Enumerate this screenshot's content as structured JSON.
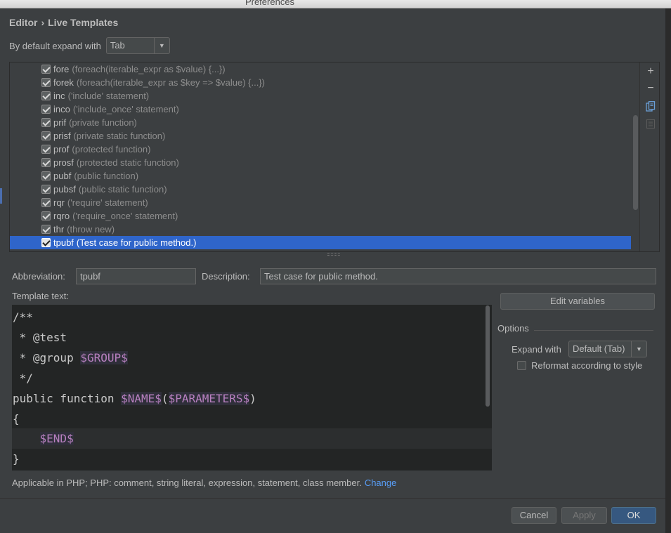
{
  "window": {
    "title": "Preferences"
  },
  "breadcrumb": {
    "parent": "Editor",
    "separator": "›",
    "current": "Live Templates"
  },
  "expand": {
    "label": "By default expand with",
    "value": "Tab"
  },
  "templates": [
    {
      "abbr": "fore",
      "desc": "(foreach(iterable_expr as $value) {...})",
      "checked": true
    },
    {
      "abbr": "forek",
      "desc": "(foreach(iterable_expr as $key => $value) {...})",
      "checked": true
    },
    {
      "abbr": "inc",
      "desc": "('include' statement)",
      "checked": true
    },
    {
      "abbr": "inco",
      "desc": "('include_once' statement)",
      "checked": true
    },
    {
      "abbr": "prif",
      "desc": "(private function)",
      "checked": true
    },
    {
      "abbr": "prisf",
      "desc": "(private static function)",
      "checked": true
    },
    {
      "abbr": "prof",
      "desc": "(protected function)",
      "checked": true
    },
    {
      "abbr": "prosf",
      "desc": "(protected static function)",
      "checked": true
    },
    {
      "abbr": "pubf",
      "desc": "(public function)",
      "checked": true
    },
    {
      "abbr": "pubsf",
      "desc": "(public static function)",
      "checked": true
    },
    {
      "abbr": "rqr",
      "desc": "('require' statement)",
      "checked": true
    },
    {
      "abbr": "rqro",
      "desc": "('require_once' statement)",
      "checked": true
    },
    {
      "abbr": "thr",
      "desc": "(throw new)",
      "checked": true
    },
    {
      "abbr": "tpubf",
      "desc": "(Test case for public method.)",
      "checked": true,
      "selected": true
    }
  ],
  "toolbar": {
    "add_icon": "plus-icon",
    "remove_icon": "minus-icon",
    "copy_icon": "copy-icon",
    "restore_icon": "restore-icon"
  },
  "form": {
    "abbreviation_label": "Abbreviation:",
    "abbreviation_value": "tpubf",
    "description_label": "Description:",
    "description_value": "Test case for public method.",
    "template_text_label": "Template text:"
  },
  "code": {
    "line1": "/**",
    "line2": " * @test",
    "line3_prefix": " * @group ",
    "line3_var": "$GROUP$",
    "line4": " */",
    "line5_prefix": "public function ",
    "line5_var1": "$NAME$",
    "line5_paren_open": "(",
    "line5_var2": "$PARAMETERS$",
    "line5_paren_close": ")",
    "line6": "{",
    "line7_indent": "    ",
    "line7_var": "$END$",
    "line8": "}"
  },
  "side": {
    "edit_variables": "Edit variables",
    "options_title": "Options",
    "expand_with_label": "Expand with",
    "expand_with_value": "Default (Tab)",
    "reformat_label": "Reformat according to style",
    "reformat_checked": false
  },
  "applicable": {
    "text": "Applicable in PHP; PHP: comment, string literal, expression, statement, class member.",
    "change_link": "Change"
  },
  "footer": {
    "cancel": "Cancel",
    "apply": "Apply",
    "ok": "OK"
  },
  "colors": {
    "background": "#3c3f41",
    "selection": "#2f65ca",
    "template_var": "#b880c0",
    "link": "#589df6",
    "ok_button": "#365880"
  }
}
